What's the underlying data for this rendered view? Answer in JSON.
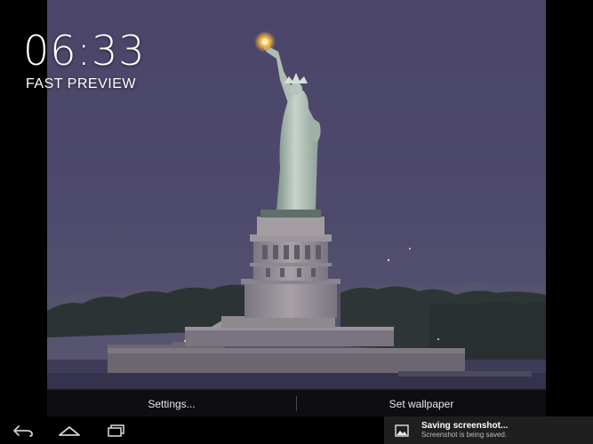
{
  "lockscreen": {
    "clock": "06:33",
    "preview_label": "FAST PREVIEW"
  },
  "wallpaper": {
    "subject": "statue-of-liberty-at-dusk"
  },
  "actions": {
    "settings_label": "Settings...",
    "set_wallpaper_label": "Set wallpaper"
  },
  "nav": {
    "back_icon": "back-icon",
    "home_icon": "home-icon",
    "recents_icon": "recents-icon"
  },
  "notification": {
    "icon": "image-icon",
    "title": "Saving screenshot...",
    "subtitle": "Screenshot is being saved."
  },
  "colors": {
    "sky": "#4a4668",
    "water": "#3b3a55",
    "statue": "#b9c6bd",
    "torch": "#ffbf45"
  }
}
